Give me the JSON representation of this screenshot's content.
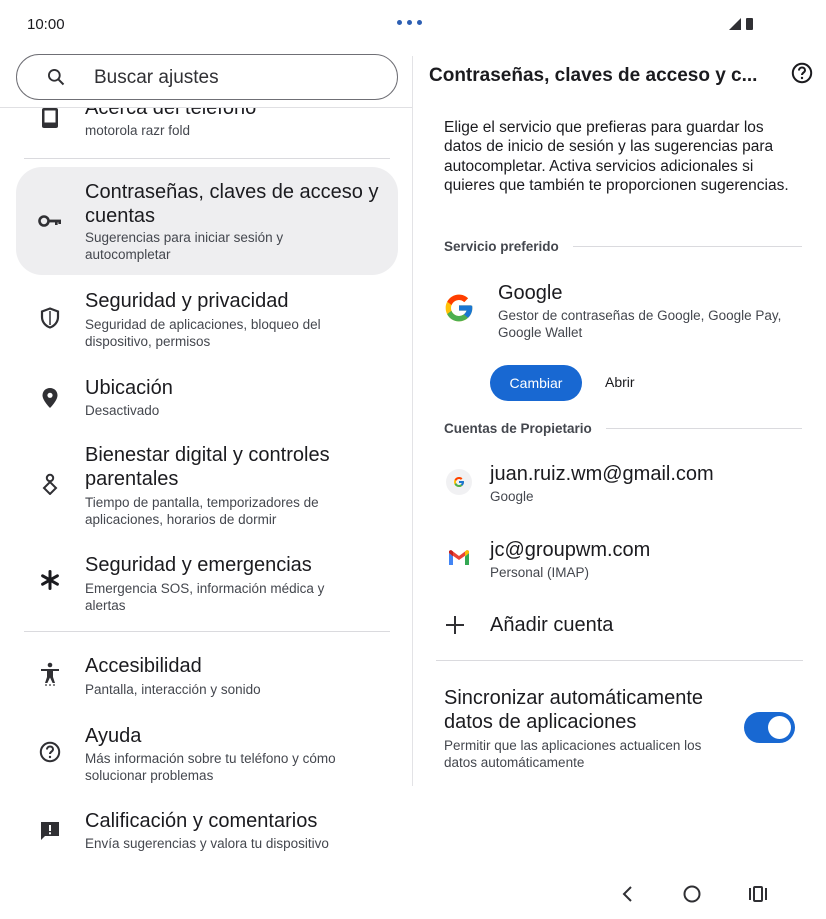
{
  "status_bar": {
    "time": "10:00"
  },
  "search": {
    "placeholder": "Buscar ajustes"
  },
  "settings_list": [
    {
      "title": "Acerca del teléfono",
      "subtitle": "motorola razr fold",
      "icon": "phone-icon"
    },
    {
      "title": "Contraseñas, claves de acceso y cuentas",
      "subtitle": "Sugerencias para iniciar sesión y autocompletar",
      "icon": "key-icon",
      "selected": true
    },
    {
      "title": "Seguridad y privacidad",
      "subtitle": "Seguridad de aplicaciones, bloqueo del dispositivo, permisos",
      "icon": "shield-icon"
    },
    {
      "title": "Ubicación",
      "subtitle": "Desactivado",
      "icon": "location-pin-icon"
    },
    {
      "title": "Bienestar digital y controles parentales",
      "subtitle": "Tiempo de pantalla, temporizadores de aplicaciones, horarios de dormir",
      "icon": "wellbeing-icon"
    },
    {
      "title": "Seguridad y emergencias",
      "subtitle": "Emergencia SOS, información médica y alertas",
      "icon": "asterisk-icon"
    },
    {
      "title": "Accesibilidad",
      "subtitle": "Pantalla, interacción y sonido",
      "icon": "accessibility-icon"
    },
    {
      "title": "Ayuda",
      "subtitle": "Más información sobre tu teléfono y cómo solucionar problemas",
      "icon": "help-icon"
    },
    {
      "title": "Calificación y comentarios",
      "subtitle": "Envía sugerencias y valora tu dispositivo",
      "icon": "feedback-icon"
    }
  ],
  "detail": {
    "title": "Contraseñas, claves de acceso y c...",
    "description": "Elige el servicio que prefieras para guardar los datos de inicio de sesión y las sugerencias para autocompletar. Activa servicios adicionales si quieres que también te proporcionen sugerencias.",
    "preferred_section": "Servicio preferido",
    "preferred_service": {
      "name": "Google",
      "subtitle": "Gestor de contraseñas de Google, Google Pay, Google Wallet",
      "change_label": "Cambiar",
      "open_label": "Abrir"
    },
    "accounts_section": "Cuentas de Propietario",
    "accounts": [
      {
        "email": "juan.ruiz.wm@gmail.com",
        "type": "Google",
        "icon": "google-icon"
      },
      {
        "email": "jc@groupwm.com",
        "type": "Personal (IMAP)",
        "icon": "gmail-icon"
      }
    ],
    "add_account_label": "Añadir cuenta",
    "sync": {
      "title": "Sincronizar automáticamente datos de aplicaciones",
      "subtitle": "Permitir que las aplicaciones actualicen los datos automáticamente",
      "enabled": true
    }
  },
  "colors": {
    "accent": "#1868d2",
    "selected_bg": "#eeeef0"
  }
}
